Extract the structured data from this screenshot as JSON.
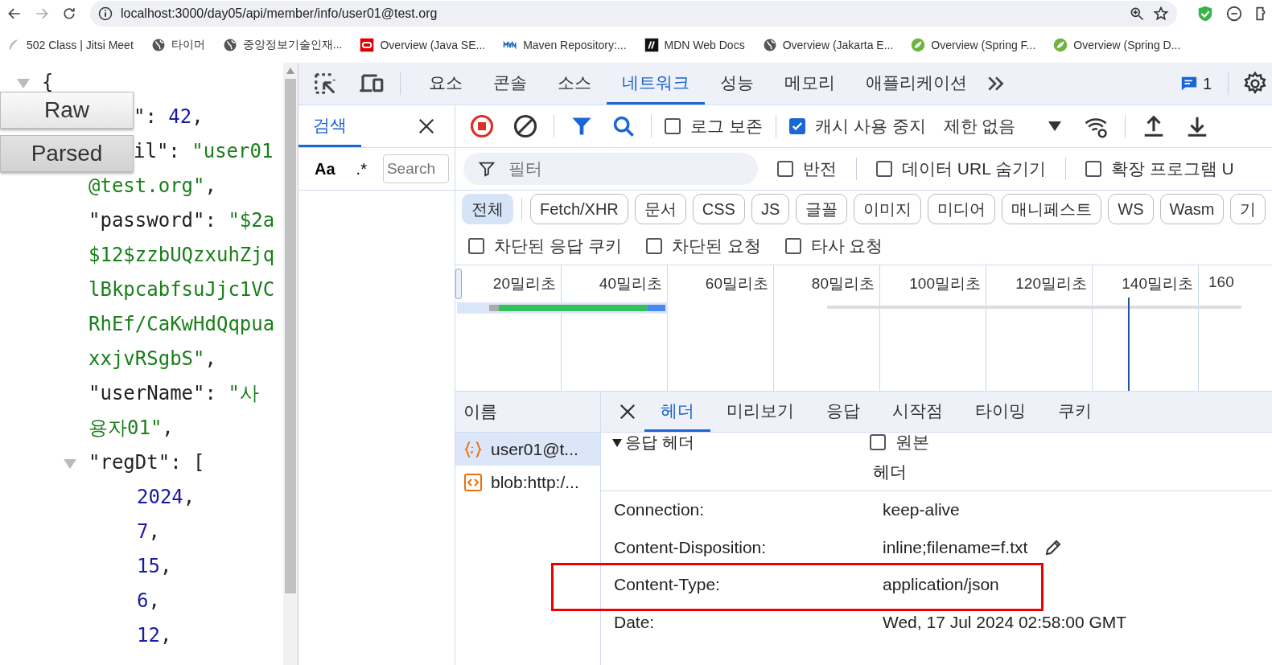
{
  "browser": {
    "url": "localhost:3000/day05/api/member/info/user01@test.org",
    "forward_disabled": true
  },
  "bookmarks": [
    {
      "kind": "feather",
      "label": "502 Class | Jitsi Meet"
    },
    {
      "kind": "globe",
      "label": "타이머"
    },
    {
      "kind": "globe",
      "label": "중앙정보기술인재..."
    },
    {
      "kind": "oracle",
      "label": "Overview (Java SE..."
    },
    {
      "kind": "mvn",
      "label": "Maven Repository:..."
    },
    {
      "kind": "mdn",
      "label": "MDN Web Docs"
    },
    {
      "kind": "globe",
      "label": "Overview (Jakarta E..."
    },
    {
      "kind": "spring",
      "label": "Overview (Spring F..."
    },
    {
      "kind": "spring",
      "label": "Overview (Spring D..."
    }
  ],
  "json_viewer": {
    "buttons": [
      {
        "label": "Raw",
        "selected": false
      },
      {
        "label": "Parsed",
        "selected": true
      }
    ],
    "lines": [
      {
        "kind": "root",
        "expanded": true,
        "tokens": [
          {
            "kind": "punct",
            "text": "{"
          }
        ]
      },
      {
        "kind": "clipped",
        "tokens": [
          {
            "kind": "punct",
            "text": "\": "
          },
          {
            "kind": "number",
            "text": "42"
          },
          {
            "kind": "punct",
            "text": ","
          }
        ]
      },
      {
        "kind": "clipped",
        "tokens": [
          {
            "kind": "punct",
            "text": "il\": "
          },
          {
            "kind": "string",
            "text": "\"user01"
          }
        ]
      },
      {
        "kind": "field",
        "tokens": [
          {
            "kind": "string",
            "text": "@test.org\""
          },
          {
            "kind": "punct",
            "text": ","
          }
        ]
      },
      {
        "kind": "field",
        "tokens": [
          {
            "kind": "punct",
            "text": "\"password\": "
          },
          {
            "kind": "string",
            "text": "\"$2a"
          }
        ]
      },
      {
        "kind": "field",
        "tokens": [
          {
            "kind": "string",
            "text": "$12$zzbUQzxuhZjq"
          }
        ]
      },
      {
        "kind": "field",
        "tokens": [
          {
            "kind": "string",
            "text": "lBkpcabfsuJjc1VC"
          }
        ]
      },
      {
        "kind": "field",
        "tokens": [
          {
            "kind": "string",
            "text": "RhEf/CaKwHdQqpua"
          }
        ]
      },
      {
        "kind": "field",
        "tokens": [
          {
            "kind": "string",
            "text": "xxjvRSgbS\""
          },
          {
            "kind": "punct",
            "text": ","
          }
        ]
      },
      {
        "kind": "field",
        "tokens": [
          {
            "kind": "punct",
            "text": "\"userName\": "
          },
          {
            "kind": "string",
            "text": "\"사"
          }
        ]
      },
      {
        "kind": "field",
        "tokens": [
          {
            "kind": "string",
            "text": "용자01\""
          },
          {
            "kind": "punct",
            "text": ","
          }
        ]
      },
      {
        "kind": "field",
        "expanded": true,
        "tokens": [
          {
            "kind": "punct",
            "text": "\"regDt\": ["
          }
        ]
      },
      {
        "kind": "item",
        "tokens": [
          {
            "kind": "number",
            "text": "2024"
          },
          {
            "kind": "punct",
            "text": ","
          }
        ]
      },
      {
        "kind": "item",
        "tokens": [
          {
            "kind": "number",
            "text": "7"
          },
          {
            "kind": "punct",
            "text": ","
          }
        ]
      },
      {
        "kind": "item",
        "tokens": [
          {
            "kind": "number",
            "text": "15"
          },
          {
            "kind": "punct",
            "text": ","
          }
        ]
      },
      {
        "kind": "item",
        "tokens": [
          {
            "kind": "number",
            "text": "6"
          },
          {
            "kind": "punct",
            "text": ","
          }
        ]
      },
      {
        "kind": "item",
        "tokens": [
          {
            "kind": "number",
            "text": "12"
          },
          {
            "kind": "punct",
            "text": ","
          }
        ]
      }
    ]
  },
  "devtools": {
    "tabs": [
      {
        "label": "요소",
        "selected": false
      },
      {
        "label": "콘솔",
        "selected": false
      },
      {
        "label": "소스",
        "selected": false
      },
      {
        "label": "네트워크",
        "selected": true
      },
      {
        "label": "성능",
        "selected": false
      },
      {
        "label": "메모리",
        "selected": false
      },
      {
        "label": "애플리케이션",
        "selected": false
      }
    ],
    "issues_count": "1",
    "drawer": {
      "tab": "검색",
      "case_label": "Aa",
      "regex_label": ".*",
      "search_placeholder": "Search"
    },
    "network": {
      "toolbar": {
        "recording": true,
        "preserve_log": {
          "label": "로그 보존",
          "checked": false
        },
        "disable_cache": {
          "label": "캐시 사용 중지",
          "checked": true
        },
        "throttling": "제한 없음"
      },
      "filter": {
        "placeholder": "필터",
        "options": [
          {
            "label": "반전",
            "checked": false
          },
          {
            "label": "데이터 URL 숨기기",
            "checked": false
          },
          {
            "label": "확장 프로그램 U",
            "checked": false
          }
        ]
      },
      "types": [
        {
          "label": "전체",
          "selected": true
        },
        {
          "label": "Fetch/XHR",
          "selected": false
        },
        {
          "label": "문서",
          "selected": false
        },
        {
          "label": "CSS",
          "selected": false
        },
        {
          "label": "JS",
          "selected": false
        },
        {
          "label": "글꼴",
          "selected": false
        },
        {
          "label": "이미지",
          "selected": false
        },
        {
          "label": "미디어",
          "selected": false
        },
        {
          "label": "매니페스트",
          "selected": false
        },
        {
          "label": "WS",
          "selected": false
        },
        {
          "label": "Wasm",
          "selected": false
        },
        {
          "label": "기",
          "selected": false
        }
      ],
      "more_filters": [
        {
          "label": "차단된 응답 쿠키",
          "checked": false
        },
        {
          "label": "차단된 요청",
          "checked": false
        },
        {
          "label": "타사 요청",
          "checked": false
        }
      ],
      "timeline": {
        "ticks": [
          "20밀리초",
          "40밀리초",
          "60밀리초",
          "80밀리초",
          "100밀리초",
          "120밀리초",
          "140밀리초",
          "160"
        ]
      },
      "requests": {
        "column": "이름",
        "rows": [
          {
            "kind": "fetch",
            "name": "user01@t...",
            "selected": true
          },
          {
            "kind": "document",
            "name": "blob:http:/...",
            "selected": false
          }
        ]
      },
      "details": {
        "tabs": [
          {
            "label": "헤더",
            "selected": true
          },
          {
            "label": "미리보기",
            "selected": false
          },
          {
            "label": "응답",
            "selected": false
          },
          {
            "label": "시작점",
            "selected": false
          },
          {
            "label": "타이밍",
            "selected": false
          },
          {
            "label": "쿠키",
            "selected": false
          }
        ],
        "section": {
          "title": "응답 헤더",
          "expanded": true
        },
        "raw": {
          "label": "원본",
          "checked": false
        },
        "column": "헤더",
        "headers": [
          {
            "name": "Connection:",
            "value": "keep-alive",
            "editable": false,
            "highlighted": false
          },
          {
            "name": "Content-Disposition:",
            "value": "inline;filename=f.txt",
            "editable": true,
            "highlighted": false
          },
          {
            "name": "Content-Type:",
            "value": "application/json",
            "editable": false,
            "highlighted": true
          },
          {
            "name": "Date:",
            "value": "Wed, 17 Jul 2024 02:58:00 GMT",
            "editable": false,
            "highlighted": false
          }
        ]
      }
    }
  }
}
